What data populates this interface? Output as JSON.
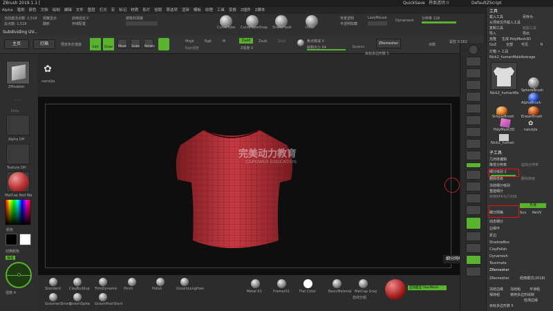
{
  "titlebar": {
    "title": "ZBrush 2019.1.1 [",
    "quicksave": "QuickSave",
    "transparency": "界面透明 0",
    "script": "DefaultZScript"
  },
  "menubar": [
    "Alpha",
    "笔刷",
    "颜色",
    "文档",
    "绘制",
    "编辑",
    "文件",
    "图层",
    "灯光",
    "宏",
    "标记",
    "材质",
    "影片",
    "拾取",
    "首选项",
    "渲染",
    "模板",
    "纹理",
    "工具",
    "变换",
    "Z插件",
    "Z脚本"
  ],
  "topshelf": {
    "active_points": "当前激活点数: 1,518",
    "total_points": "总点数: 1,518",
    "project": "观察显示",
    "reset": "翻新",
    "custom": "启用自定义",
    "saveconfig": "存储配置",
    "mirror_merge": "镜像并焊接",
    "curve_tube": "CurveTube",
    "curve_snap": "CurveTubeSnap",
    "snakehook": "SnakeHook",
    "inflat": "Inflat",
    "bg_sculpt": "背景透明",
    "spotlight": "半透明隐藏",
    "lazymouse": "LazyMouse",
    "dynamesh": "Dynamesh",
    "subdivision": "分辨率 128"
  },
  "subtitle": "Subdividing UV...",
  "toolbar2": {
    "home": "主页",
    "light": "灯箱",
    "preview": "预览布尔渲染",
    "edit": "Edit",
    "draw": "Draw",
    "move": "Move",
    "scale": "Scale",
    "rotate": "Rotate",
    "mrgb": "Mrgb",
    "rgb": "Rgb",
    "m": "M",
    "zadd": "Zadd",
    "zsub": "Zsub",
    "zcut": "Zcut",
    "rgb_intensity": "Rgb强度",
    "z_intensity": "Z强度 0",
    "focal_shift": "焦点衰减 0",
    "draw_size": "绘制大小 64",
    "dynamic": "Dynamic",
    "zremesher": "ZRemesher",
    "target_polys": "目标多边形数 5",
    "points_info": "点数",
    "symmetry": "紧密 0.162"
  },
  "leftshelf": {
    "zmodeler": "ZModeler",
    "dots": "Dots",
    "alpha_off": "Alpha Off",
    "texture_off": "Texture Off",
    "matcap": "MatCap Red Wa",
    "gradient": "渐变",
    "switch_color": "切换颜色",
    "color_label": "颜色",
    "intensity": "强度 A"
  },
  "viewport": {
    "watermark_cn": "完美动力教育",
    "watermark_en": "CGPOWER EDUCATION",
    "icon_label": "nanzijia"
  },
  "bottomshelf": {
    "brushes": [
      "Standard",
      "ClayBuildup",
      "TrimDynamic",
      "Pinch",
      "Polish",
      "GroomLengthen",
      "GroomerStrong",
      "GroomSpike",
      "GroomHairShort"
    ],
    "materials": [
      "Metal 01",
      "Framer01",
      "Flat Color",
      "BasicMaterial",
      "MatCap Gray"
    ],
    "autogroup": "自动分组",
    "wireframe_label": "自动显示",
    "fibermesh": "自动面显 FiberMesh",
    "tooltip": "细分网格  Ctrl+D"
  },
  "rightpanel": {
    "header": "工具",
    "load": "载入工具",
    "save_as": "另存为",
    "import_project": "从项目文件载入工具",
    "copy_tool": "复制工具",
    "paste_tool": "粘贴工具",
    "import": "导入",
    "export": "导出",
    "clone": "克隆",
    "make_polymesh": "生成 PolyMesh3D",
    "goz": "GoZ",
    "all": "全部",
    "visible": "可见",
    "r": "R",
    "lightbox_tool": "灯箱 > 工具",
    "current_tool": "Nick2_humanMaleAverage",
    "thumbs": [
      "Nick2_humanMa",
      "SphereBrush",
      "AlphaBrush",
      "SimpleBrush",
      "EraserBrush",
      "PolyMesh3D",
      "nanzijia",
      "Nick2_human"
    ],
    "subtool": "子工具",
    "geometry": "几何体编辑",
    "lower_res": "降低分辨率",
    "higher_res": "提高分辨率",
    "sdiv": "细分级别 2",
    "delete_lower": "删除低级",
    "delete_higher": "删除高级",
    "freeze": "冻结细分级别",
    "reconstruct": "重建细分",
    "convert_bpr": "转换BPR为几何体",
    "divide": "细分网格",
    "smt": "光滑",
    "suv": "Suv",
    "reuv": "ReUV",
    "dynamic_sub": "动态细分",
    "edge_loop": "边缘环",
    "crease": "折边",
    "shadowbox": "ShadowBox",
    "claypolish": "ClayPolish",
    "dynamesh_panel": "Dynamesh",
    "tessimate": "Tessimate",
    "zremesher_section": "ZRemesher",
    "zremesher_btn": "ZRemesher",
    "legacy": "经典模式(2018)",
    "freeze_border": "冻结边缘",
    "freeze_groups": "冻结组",
    "keep_groups": "保持组",
    "smooth_groups": "平滑组",
    "detect_edges": "检测边缘",
    "use_polypaint": "使用多边形绘制",
    "half": "一半",
    "same": "相同",
    "double": "加倍",
    "adapt": "自适应",
    "target_polys": "目标多边形数 5"
  },
  "colors": {
    "accent_green": "#59b32f",
    "highlight_red": "#ee1111",
    "shirt_red": "#b8323a"
  }
}
